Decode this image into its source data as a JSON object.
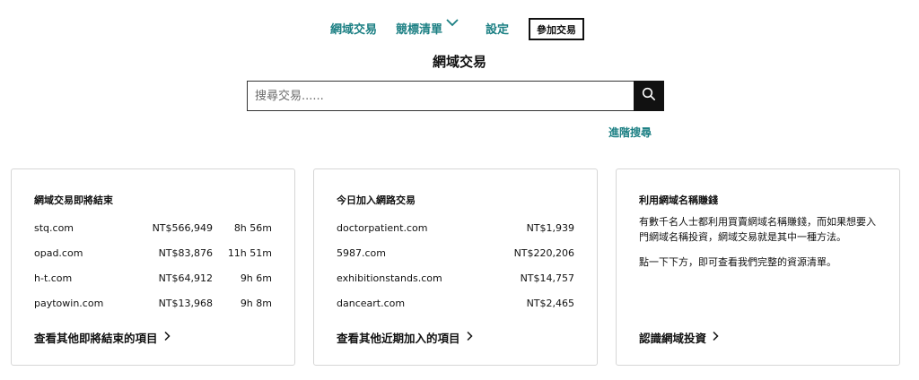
{
  "nav": {
    "items": [
      {
        "label": "網域交易"
      },
      {
        "label": "競標清單"
      },
      {
        "label": "設定"
      }
    ],
    "join_label": "參加交易"
  },
  "page": {
    "title": "網域交易"
  },
  "search": {
    "placeholder": "搜尋交易......",
    "advanced_label": "進階搜尋"
  },
  "cards": {
    "ending": {
      "title": "網域交易即將結束",
      "rows": [
        {
          "name": "stq.com",
          "price": "NT$566,949",
          "time": "8h 56m"
        },
        {
          "name": "opad.com",
          "price": "NT$83,876",
          "time": "11h 51m"
        },
        {
          "name": "h-t.com",
          "price": "NT$64,912",
          "time": "9h 6m"
        },
        {
          "name": "paytowin.com",
          "price": "NT$13,968",
          "time": "9h 8m"
        }
      ],
      "link": "查看其他即將結束的項目"
    },
    "new_today": {
      "title": "今日加入網路交易",
      "rows": [
        {
          "name": "doctorpatient.com",
          "price": "NT$1,939"
        },
        {
          "name": "5987.com",
          "price": "NT$220,206"
        },
        {
          "name": "exhibitionstands.com",
          "price": "NT$14,757"
        },
        {
          "name": "danceart.com",
          "price": "NT$2,465"
        }
      ],
      "link": "查看其他近期加入的項目"
    },
    "earn": {
      "title": "利用網域名稱賺錢",
      "text1": "有數千名人士都利用買賣網域名稱賺錢，而如果想要入門網域名稱投資，網域交易就是其中一種方法。",
      "text2": "點一下下方，即可查看我們完整的資源清單。",
      "link": "認識網域投資"
    }
  },
  "colors": {
    "accent": "#1b7f83",
    "text": "#111111",
    "border": "#d6d6d6"
  },
  "icons": {
    "search": "search-icon",
    "dropdown": "chevron-down-icon",
    "link_arrow": "chevron-right-icon"
  }
}
